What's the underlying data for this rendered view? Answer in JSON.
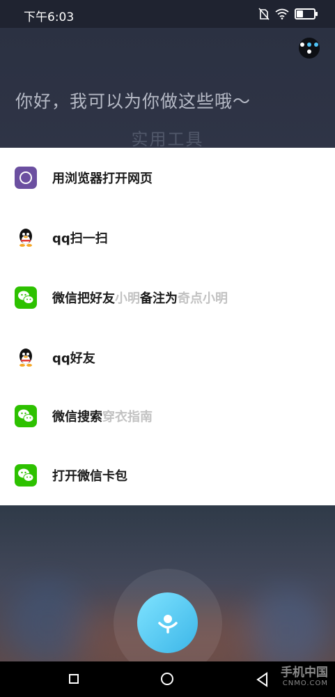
{
  "status_bar": {
    "time": "下午6:03",
    "battery_level": 0.35
  },
  "header": {
    "greeting": "你好，我可以为你做这些哦～",
    "section_title": "实用工具"
  },
  "suggestions": [
    {
      "icon": "browser-icon",
      "text": "用浏览器打开网页",
      "parts": []
    },
    {
      "icon": "qq-icon",
      "text": "qq扫一扫",
      "parts": []
    },
    {
      "icon": "wechat-icon",
      "parts": [
        {
          "t": "微信把好友",
          "hint": false
        },
        {
          "t": "小明",
          "hint": true
        },
        {
          "t": "备注为",
          "hint": false
        },
        {
          "t": "奇点小明",
          "hint": true
        }
      ]
    },
    {
      "icon": "qq-icon",
      "text": "qq好友",
      "parts": []
    },
    {
      "icon": "wechat-icon",
      "parts": [
        {
          "t": "微信搜索",
          "hint": false
        },
        {
          "t": "穿衣指南",
          "hint": true
        }
      ]
    },
    {
      "icon": "wechat-icon",
      "text": "打开微信卡包",
      "parts": []
    }
  ],
  "watermark": {
    "line1": "手机中国",
    "line2": "CNMO.COM"
  },
  "colors": {
    "wechat": "#2dc100",
    "browser": "#6b4fa0",
    "mic": "#4cc4f0"
  }
}
